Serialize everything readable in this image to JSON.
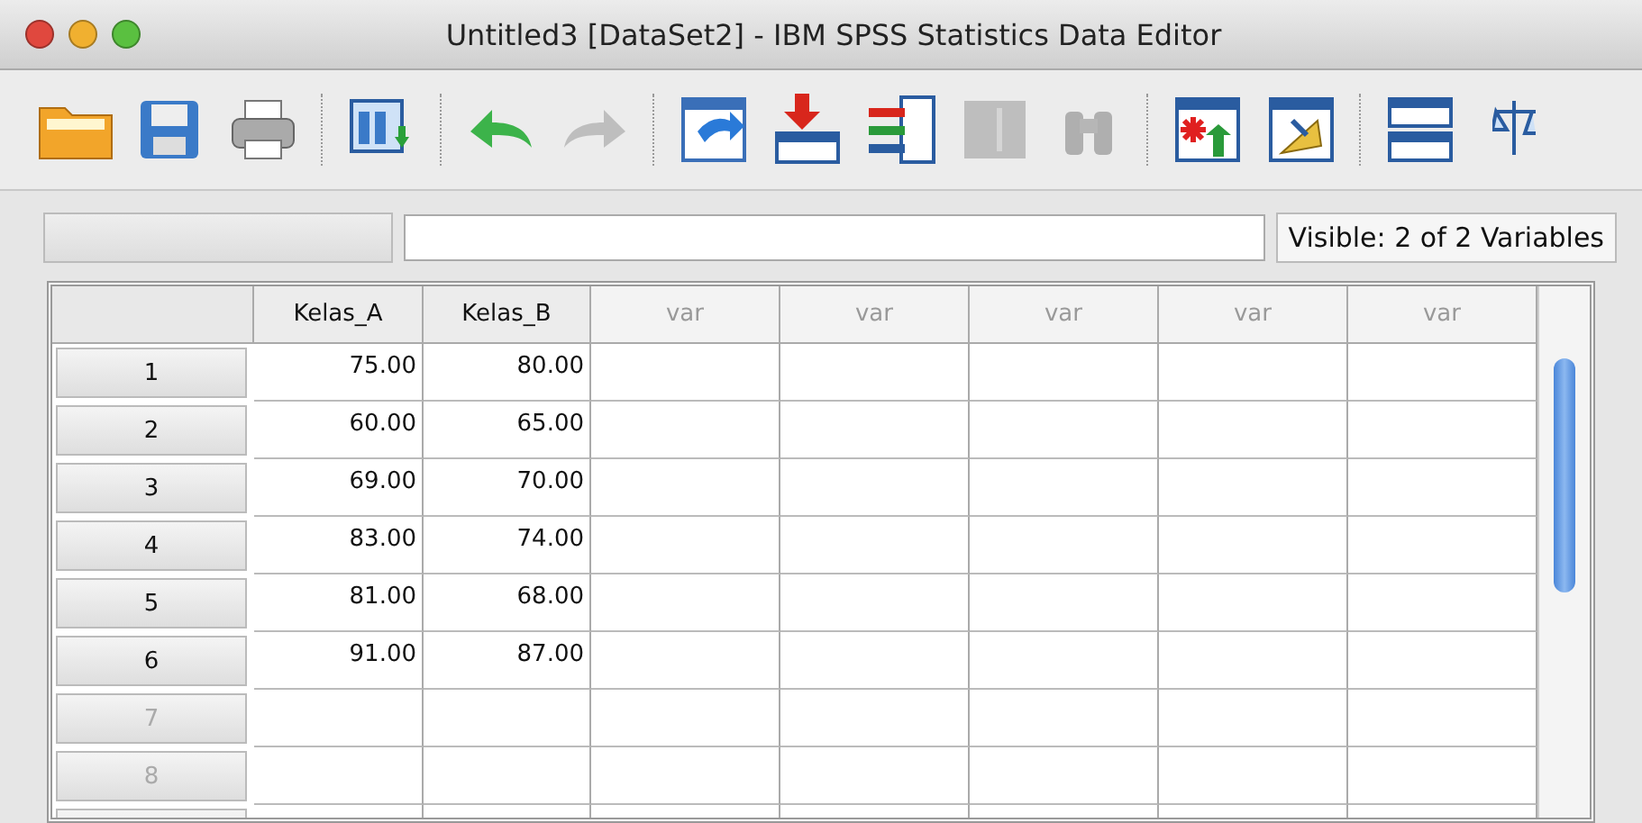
{
  "window": {
    "title": "Untitled3 [DataSet2] - IBM SPSS Statistics Data Editor"
  },
  "toolbar": {
    "buttons": [
      {
        "kind": "open",
        "disabled": false
      },
      {
        "kind": "save",
        "disabled": false
      },
      {
        "kind": "print",
        "disabled": false
      },
      {
        "kind": "dialog",
        "disabled": false
      },
      {
        "kind": "undo",
        "disabled": false
      },
      {
        "kind": "redo",
        "disabled": true
      },
      {
        "kind": "goto",
        "disabled": false
      },
      {
        "kind": "insert-case",
        "disabled": false
      },
      {
        "kind": "insert-variable",
        "disabled": false
      },
      {
        "kind": "split",
        "disabled": true
      },
      {
        "kind": "find",
        "disabled": true
      },
      {
        "kind": "select",
        "disabled": false
      },
      {
        "kind": "weight",
        "disabled": false
      },
      {
        "kind": "table",
        "disabled": false
      },
      {
        "kind": "scale",
        "disabled": false
      }
    ]
  },
  "status": {
    "visible": "Visible: 2 of 2 Variables"
  },
  "table": {
    "columns": [
      {
        "label": "Kelas_A",
        "kind": "variable"
      },
      {
        "label": "Kelas_B",
        "kind": "variable"
      },
      {
        "label": "var",
        "kind": "placeholder"
      },
      {
        "label": "var",
        "kind": "placeholder"
      },
      {
        "label": "var",
        "kind": "placeholder"
      },
      {
        "label": "var",
        "kind": "placeholder"
      },
      {
        "label": "var",
        "kind": "placeholder"
      }
    ],
    "rows": [
      {
        "label": "1",
        "greyed": false,
        "values": [
          "75.00",
          "80.00"
        ]
      },
      {
        "label": "2",
        "greyed": false,
        "values": [
          "60.00",
          "65.00"
        ]
      },
      {
        "label": "3",
        "greyed": false,
        "values": [
          "69.00",
          "70.00"
        ]
      },
      {
        "label": "4",
        "greyed": false,
        "values": [
          "83.00",
          "74.00"
        ]
      },
      {
        "label": "5",
        "greyed": false,
        "values": [
          "81.00",
          "68.00"
        ]
      },
      {
        "label": "6",
        "greyed": false,
        "values": [
          "91.00",
          "87.00"
        ]
      },
      {
        "label": "7",
        "greyed": true,
        "values": []
      },
      {
        "label": "8",
        "greyed": true,
        "values": []
      }
    ]
  }
}
